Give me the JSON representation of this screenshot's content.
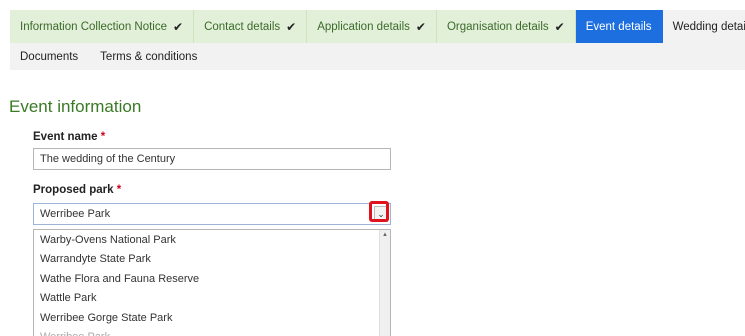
{
  "tabs": [
    {
      "label": "Information Collection Notice",
      "status": "done"
    },
    {
      "label": "Contact details",
      "status": "done"
    },
    {
      "label": "Application details",
      "status": "done"
    },
    {
      "label": "Organisation details",
      "status": "done"
    },
    {
      "label": "Event details",
      "status": "active"
    },
    {
      "label": "Wedding details",
      "status": "pending"
    }
  ],
  "tabs_row2": [
    {
      "label": "Documents"
    },
    {
      "label": "Terms & conditions"
    }
  ],
  "check_glyph": "✔",
  "section": {
    "title": "Event information"
  },
  "form": {
    "event_name": {
      "label": "Event name",
      "required_mark": "*",
      "value": "The wedding of the Century"
    },
    "proposed_park": {
      "label": "Proposed park",
      "required_mark": "*",
      "value": "Werribee Park",
      "button_glyph": "⌄"
    }
  },
  "dropdown": {
    "options": [
      "Warby-Ovens National Park",
      "Warrandyte State Park",
      "Wathe Flora and Fauna Reserve",
      "Wattle Park",
      "Werribee Gorge State Park",
      "Werribee Park"
    ],
    "scroll_up_glyph": "▲"
  },
  "colors": {
    "tab_done_bg": "#e2efd9",
    "tab_active_bg": "#1d6fe0",
    "section_title": "#3a7a25",
    "required": "#d0021b",
    "highlight": "#e0121b"
  }
}
